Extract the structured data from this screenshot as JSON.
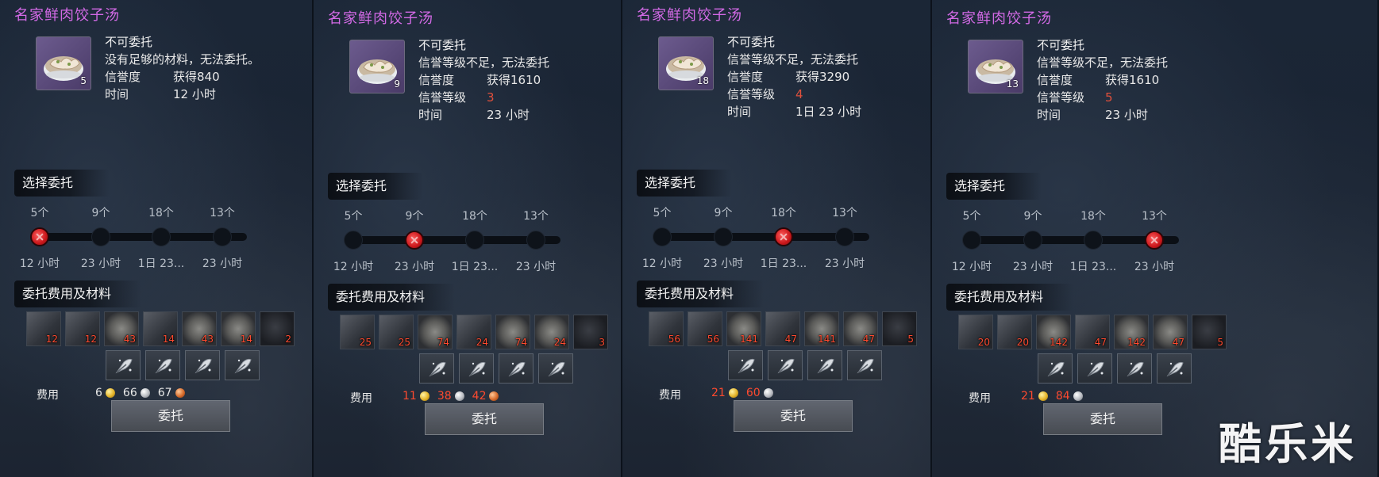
{
  "panels": [
    {
      "title": "名家鲜肉饺子汤",
      "item_qty": "5",
      "status": "不可委托",
      "reason": "没有足够的材料，无法委托。",
      "rep_label": "信誉度",
      "rep_value": "获得840",
      "level_label": "",
      "level_value": "",
      "time_label": "时间",
      "time_value": "12 小时",
      "select_label": "选择委托",
      "options": [
        {
          "count": "5个",
          "time": "12 小时"
        },
        {
          "count": "9个",
          "time": "23 小时"
        },
        {
          "count": "18个",
          "time": "1日 23..."
        },
        {
          "count": "13个",
          "time": "23 小时"
        }
      ],
      "selected_index": 0,
      "materials_label": "委托费用及材料",
      "materials": [
        "12",
        "12",
        "43",
        "14",
        "43",
        "14",
        "2"
      ],
      "fee_label": "费用",
      "fees": [
        {
          "value": "6",
          "coin": "gold"
        },
        {
          "value": "66",
          "coin": "silver"
        },
        {
          "value": "67",
          "coin": "copper"
        }
      ],
      "fee_red": false,
      "button": "委托"
    },
    {
      "title": "名家鲜肉饺子汤",
      "item_qty": "9",
      "status": "不可委托",
      "reason": "信誉等级不足，无法委托",
      "rep_label": "信誉度",
      "rep_value": "获得1610",
      "level_label": "信誉等级",
      "level_value": "3",
      "time_label": "时间",
      "time_value": "23 小时",
      "select_label": "选择委托",
      "options": [
        {
          "count": "5个",
          "time": "12 小时"
        },
        {
          "count": "9个",
          "time": "23 小时"
        },
        {
          "count": "18个",
          "time": "1日 23..."
        },
        {
          "count": "13个",
          "time": "23 小时"
        }
      ],
      "selected_index": 1,
      "materials_label": "委托费用及材料",
      "materials": [
        "25",
        "25",
        "74",
        "24",
        "74",
        "24",
        "3"
      ],
      "fee_label": "费用",
      "fees": [
        {
          "value": "11",
          "coin": "gold"
        },
        {
          "value": "38",
          "coin": "silver"
        },
        {
          "value": "42",
          "coin": "copper"
        }
      ],
      "fee_red": true,
      "button": "委托"
    },
    {
      "title": "名家鲜肉饺子汤",
      "item_qty": "18",
      "status": "不可委托",
      "reason": "信誉等级不足，无法委托",
      "rep_label": "信誉度",
      "rep_value": "获得3290",
      "level_label": "信誉等级",
      "level_value": "4",
      "time_label": "时间",
      "time_value": "1日 23 小时",
      "select_label": "选择委托",
      "options": [
        {
          "count": "5个",
          "time": "12 小时"
        },
        {
          "count": "9个",
          "time": "23 小时"
        },
        {
          "count": "18个",
          "time": "1日 23..."
        },
        {
          "count": "13个",
          "time": "23 小时"
        }
      ],
      "selected_index": 2,
      "materials_label": "委托费用及材料",
      "materials": [
        "56",
        "56",
        "141",
        "47",
        "141",
        "47",
        "5"
      ],
      "fee_label": "费用",
      "fees": [
        {
          "value": "21",
          "coin": "gold"
        },
        {
          "value": "60",
          "coin": "silver"
        }
      ],
      "fee_red": true,
      "button": "委托"
    },
    {
      "title": "名家鲜肉饺子汤",
      "item_qty": "13",
      "status": "不可委托",
      "reason": "信誉等级不足，无法委托",
      "rep_label": "信誉度",
      "rep_value": "获得1610",
      "level_label": "信誉等级",
      "level_value": "5",
      "time_label": "时间",
      "time_value": "23 小时",
      "select_label": "选择委托",
      "options": [
        {
          "count": "5个",
          "time": "12 小时"
        },
        {
          "count": "9个",
          "time": "23 小时"
        },
        {
          "count": "18个",
          "time": "1日 23..."
        },
        {
          "count": "13个",
          "time": "23 小时"
        }
      ],
      "selected_index": 3,
      "materials_label": "委托费用及材料",
      "materials": [
        "20",
        "20",
        "142",
        "47",
        "142",
        "47",
        "5"
      ],
      "fee_label": "费用",
      "fees": [
        {
          "value": "21",
          "coin": "gold"
        },
        {
          "value": "84",
          "coin": "silver"
        }
      ],
      "fee_red": true,
      "button": "委托"
    }
  ],
  "watermark": "酷乐米",
  "colors": {
    "title": "#d36ae6",
    "red_value": "#e0503c",
    "material_count": "#ff4a2f"
  },
  "icons": {
    "item": "dumpling-soup-icon",
    "tool": "leaf-sprout-icon",
    "coins": [
      "gold-coin-icon",
      "silver-coin-icon",
      "copper-coin-icon"
    ],
    "selected_node": "red-x-marker-icon"
  }
}
